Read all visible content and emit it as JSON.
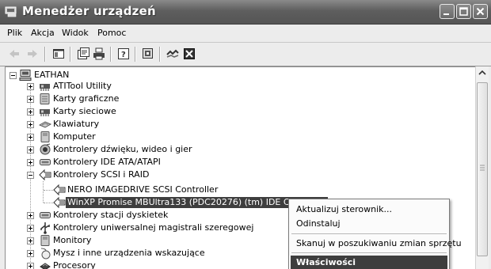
{
  "window": {
    "title": "Menedżer urządzeń"
  },
  "menubar": {
    "items": [
      "Plik",
      "Akcja",
      "Widok",
      "Pomoc"
    ]
  },
  "toolbar": {
    "buttons": [
      "back-icon",
      "forward-icon",
      "console-tree-icon",
      "properties-icon",
      "print-icon",
      "help-icon",
      "scan-hardware-icon",
      "update-driver-icon",
      "uninstall-icon"
    ]
  },
  "tree": {
    "root": "EATHAN",
    "categories": [
      {
        "label": "ATITool Utility",
        "icon": "network-card-icon"
      },
      {
        "label": "Karty graficzne",
        "icon": "display-adapter-icon"
      },
      {
        "label": "Karty sieciowe",
        "icon": "network-card-icon"
      },
      {
        "label": "Klawiatury",
        "icon": "keyboard-icon"
      },
      {
        "label": "Komputer",
        "icon": "computer-icon"
      },
      {
        "label": "Kontrolery dźwięku, wideo i gier",
        "icon": "sound-icon"
      },
      {
        "label": "Kontrolery IDE ATA/ATAPI",
        "icon": "ide-controller-icon"
      },
      {
        "label": "Kontrolery SCSI i RAID",
        "icon": "scsi-controller-icon",
        "expanded": true,
        "children": [
          "NERO IMAGEDRIVE SCSI Controller",
          "WinXP Promise MBUltra133 (PDC20276) (tm) IDE Controller"
        ]
      },
      {
        "label": "Kontrolery stacji dyskietek",
        "icon": "floppy-controller-icon"
      },
      {
        "label": "Kontrolery uniwersalnej magistrali szeregowej",
        "icon": "usb-icon"
      },
      {
        "label": "Monitory",
        "icon": "monitor-icon"
      },
      {
        "label": "Mysz i inne urządzenia wskazujące",
        "icon": "mouse-icon"
      },
      {
        "label": "Procesory",
        "icon": "processor-icon"
      }
    ],
    "selected": "WinXP Promise MBUltra133 (PDC20276) (tm) IDE Controller"
  },
  "context_menu": {
    "items": [
      "Aktualizuj sterownik...",
      "Odinstaluj",
      "Skanuj w poszukiwaniu zmian sprzętu",
      "Właściwości"
    ],
    "highlighted": "Właściwości"
  }
}
